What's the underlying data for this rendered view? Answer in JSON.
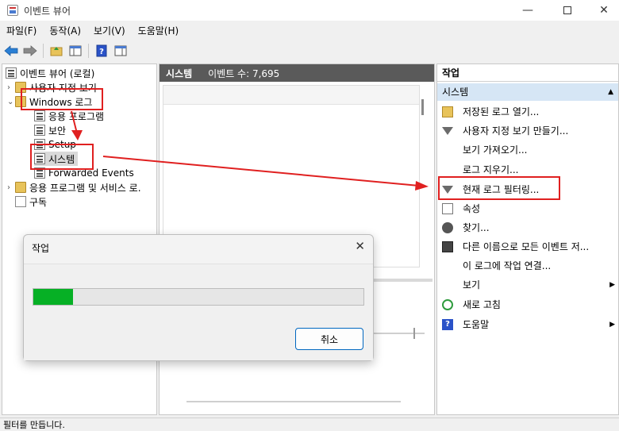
{
  "window": {
    "title": "이벤트 뷰어",
    "min_symbol": "—",
    "close_symbol": "✕"
  },
  "menu": [
    "파일(F)",
    "동작(A)",
    "보기(V)",
    "도움말(H)"
  ],
  "tree": {
    "root": "이벤트 뷰어 (로컬)",
    "custom_views": "사용자 지정 보기",
    "windows_logs": "Windows 로그",
    "application": "응용 프로그램",
    "security": "보안",
    "setup": "Setup",
    "system": "시스템",
    "forwarded": "Forwarded Events",
    "apps_services": "응용 프로그램 및 서비스 로.",
    "subscriptions": "구독"
  },
  "middle": {
    "title": "시스템",
    "event_count": "이벤트 수: 7,695"
  },
  "actions": {
    "header": "작업",
    "section": "시스템",
    "items": [
      {
        "label": "저장된 로그 열기...",
        "icon": "folder-open-icon"
      },
      {
        "label": "사용자 지정 보기 만들기...",
        "icon": "filter-icon"
      },
      {
        "label": "보기 가져오기...",
        "icon": ""
      },
      {
        "label": "로그 지우기...",
        "icon": ""
      },
      {
        "label": "현재 로그 필터링...",
        "icon": "filter-icon"
      },
      {
        "label": "속성",
        "icon": "properties-icon"
      },
      {
        "label": "찾기...",
        "icon": "binoculars-icon"
      },
      {
        "label": "다른 이름으로 모든 이벤트 저...",
        "icon": "save-icon"
      },
      {
        "label": "이 로그에 작업 연결...",
        "icon": ""
      },
      {
        "label": "보기",
        "icon": "",
        "submenu": true
      },
      {
        "label": "새로 고침",
        "icon": "refresh-icon"
      },
      {
        "label": "도움말",
        "icon": "help-icon",
        "submenu": true
      }
    ]
  },
  "status": "필터를 만듭니다.",
  "dialog": {
    "title": "작업",
    "cancel": "취소",
    "progress": 0.12,
    "close_symbol": "✕"
  },
  "colors": {
    "annotation": "#e02020",
    "progress": "#06b025",
    "section_bg": "#d6e6f5"
  }
}
